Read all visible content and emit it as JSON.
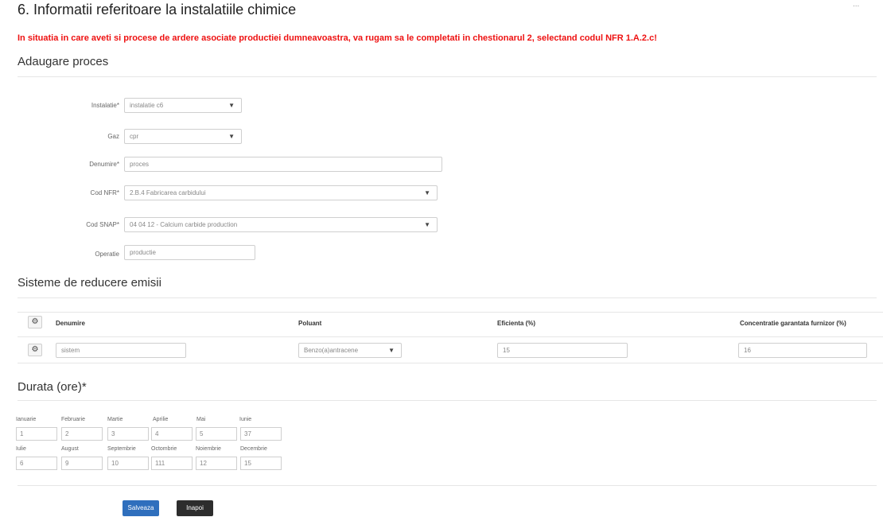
{
  "page": {
    "title": "6. Informatii referitoare la instalatiile chimice",
    "corner_text": "...",
    "warning": "In situatia in care aveti si procese de ardere asociate productiei dumneavoastra, va rugam sa le completati in chestionarul 2, selectand codul NFR 1.A.2.c!"
  },
  "process": {
    "title": "Adaugare proces",
    "fields": {
      "instalatie": {
        "label": "Instalatie*",
        "value": "instalatie c6"
      },
      "gaz": {
        "label": "Gaz",
        "value": "cpr"
      },
      "denumire": {
        "label": "Denumire*",
        "value": "proces"
      },
      "cod_nfr": {
        "label": "Cod NFR*",
        "value": "2.B.4 Fabricarea carbidului"
      },
      "cod_snap": {
        "label": "Cod SNAP*",
        "value": "04 04 12 - Calcium carbide production"
      },
      "operatie": {
        "label": "Operatie",
        "value": "productie"
      }
    }
  },
  "reduction": {
    "title": "Sisteme de reducere emisii",
    "headers": {
      "denumire": "Denumire",
      "poluant": "Poluant",
      "eficienta": "Eficienta (%)",
      "concentratie": "Concentratie garantata furnizor (%)"
    },
    "row": {
      "denumire": "sistem",
      "poluant": "Benzo(a)antracene",
      "eficienta": "15",
      "concentratie": "16"
    }
  },
  "duration": {
    "title": "Durata (ore)*",
    "months": [
      {
        "name": "Ianuarie",
        "value": "1"
      },
      {
        "name": "Februarie",
        "value": "2"
      },
      {
        "name": "Martie",
        "value": "3"
      },
      {
        "name": "Aprilie",
        "value": "4"
      },
      {
        "name": "Mai",
        "value": "5"
      },
      {
        "name": "Iunie",
        "value": "37"
      },
      {
        "name": "Iulie",
        "value": "6"
      },
      {
        "name": "August",
        "value": "9"
      },
      {
        "name": "Septembrie",
        "value": "10"
      },
      {
        "name": "Octombrie",
        "value": "111"
      },
      {
        "name": "Noiembrie",
        "value": "12"
      },
      {
        "name": "Decembrie",
        "value": "15"
      }
    ]
  },
  "actions": {
    "save": "Salveaza",
    "back": "Inapoi"
  },
  "colors": {
    "warning": "#ee1111",
    "save_button": "#2f6fbd",
    "back_button": "#2d2d2d"
  }
}
